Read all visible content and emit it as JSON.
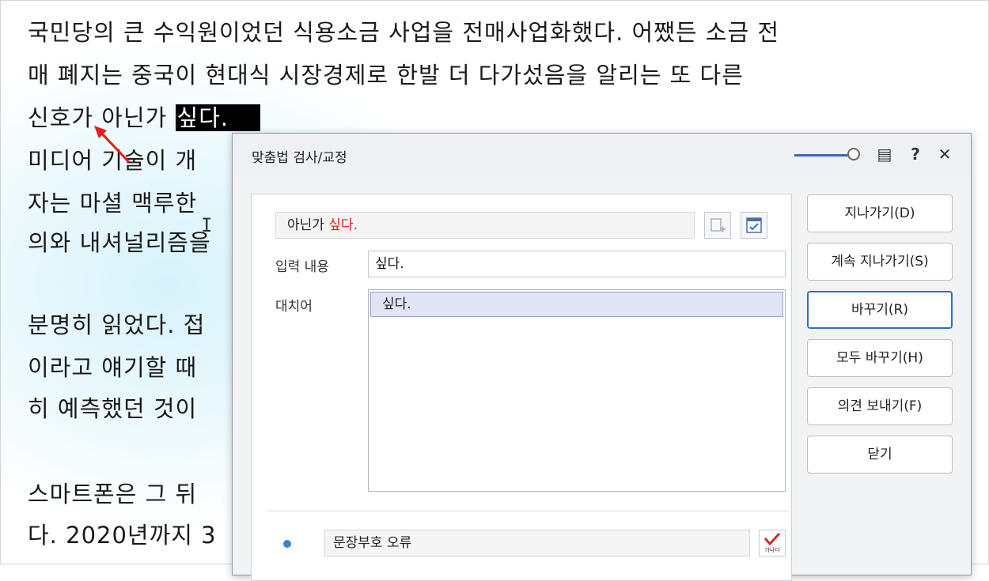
{
  "document": {
    "lines": [
      "국민당의 큰 수익원이었던 식용소금 사업을 전매사업화했다. 어쨌든 소금 전",
      "매 폐지는 중국이 현대식 시장경제로 한발 더 다가섰음을 알리는 또 다른",
      "신호가 아닌가 ",
      "미디어 기술이 개",
      "자는 마셜 맥루한",
      "의와 내셔널리즘을",
      "분명히 읽었다. 접",
      "이라고 얘기할 때",
      "히 예측했던 것이",
      "스마트폰은 그 뒤",
      "다. 2020년까지 3"
    ],
    "selected_text": "싶다."
  },
  "dialog": {
    "title": "맞춤법 검사/교정",
    "sentence_prefix": "아닌가 ",
    "sentence_error": "싶다.",
    "input_label": "입력 내용",
    "input_value": "싶다.",
    "suggestions_label": "대치어",
    "suggestions": [
      "싶다."
    ],
    "error_type": "문장부호 오류",
    "buttons": {
      "skip": "지나가기(D)",
      "skip_all": "계속 지나가기(S)",
      "replace": "바꾸기(R)",
      "replace_all": "모두 바꾸기(H)",
      "send_feedback": "의견 보내기(F)",
      "close": "닫기"
    },
    "title_icons": {
      "help": "?",
      "close": "✕",
      "notes": "▤"
    },
    "check_icon_text": "가나다"
  },
  "colors": {
    "accent": "#2b6ed1",
    "error_text": "#e8161d",
    "squiggle": "#ff9d3a"
  }
}
